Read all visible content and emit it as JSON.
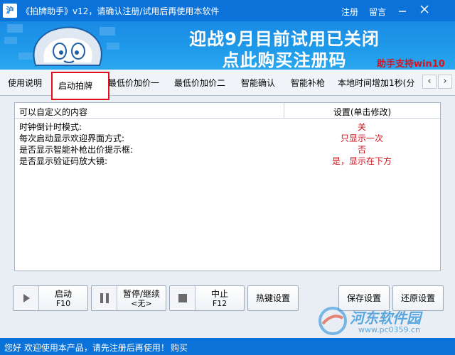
{
  "window": {
    "icon_text": "沪",
    "title": "《拍牌助手》v12，请确认注册/试用后再使用本软件",
    "register_link": "注册",
    "message_link": "留言"
  },
  "banner": {
    "line1": "迎战9月目前试用已关闭",
    "line2": "点此购买注册码",
    "note": "助手支持win10"
  },
  "tabs": [
    {
      "label": "使用说明"
    },
    {
      "label": "启动拍牌"
    },
    {
      "label": "最低价加价一"
    },
    {
      "label": "最低价加价二"
    },
    {
      "label": "智能确认"
    },
    {
      "label": "智能补枪"
    },
    {
      "label": "本地时间增加1秒(分"
    }
  ],
  "grid": {
    "col1_header": "可以自定义的内容",
    "col2_header": "设置(单击修改)",
    "rows": [
      {
        "key": "时钟倒计时模式:",
        "value": "关"
      },
      {
        "key": "每次启动显示欢迎界面方式:",
        "value": "只显示一次"
      },
      {
        "key": "是否显示智能补枪出价提示框:",
        "value": "否"
      },
      {
        "key": "是否显示验证码放大镜:",
        "value": "是，显示在下方"
      }
    ]
  },
  "buttons": {
    "start_label": "启动",
    "start_key": "F10",
    "pause_label": "暂停/继续",
    "pause_key": "<无>",
    "stop_label": "中止",
    "stop_key": "F12",
    "hotkey_label": "热键设置",
    "save_label": "保存设置",
    "restore_label": "还原设置"
  },
  "status": {
    "text": "您好 欢迎使用本产品，请先注册后再使用！",
    "buy": "购买"
  },
  "watermark": {
    "title": "河东软件园",
    "url": "www.pc0359.cn"
  },
  "colors": {
    "titlebar": "#0a72d8",
    "accent_red": "#e2101c"
  }
}
